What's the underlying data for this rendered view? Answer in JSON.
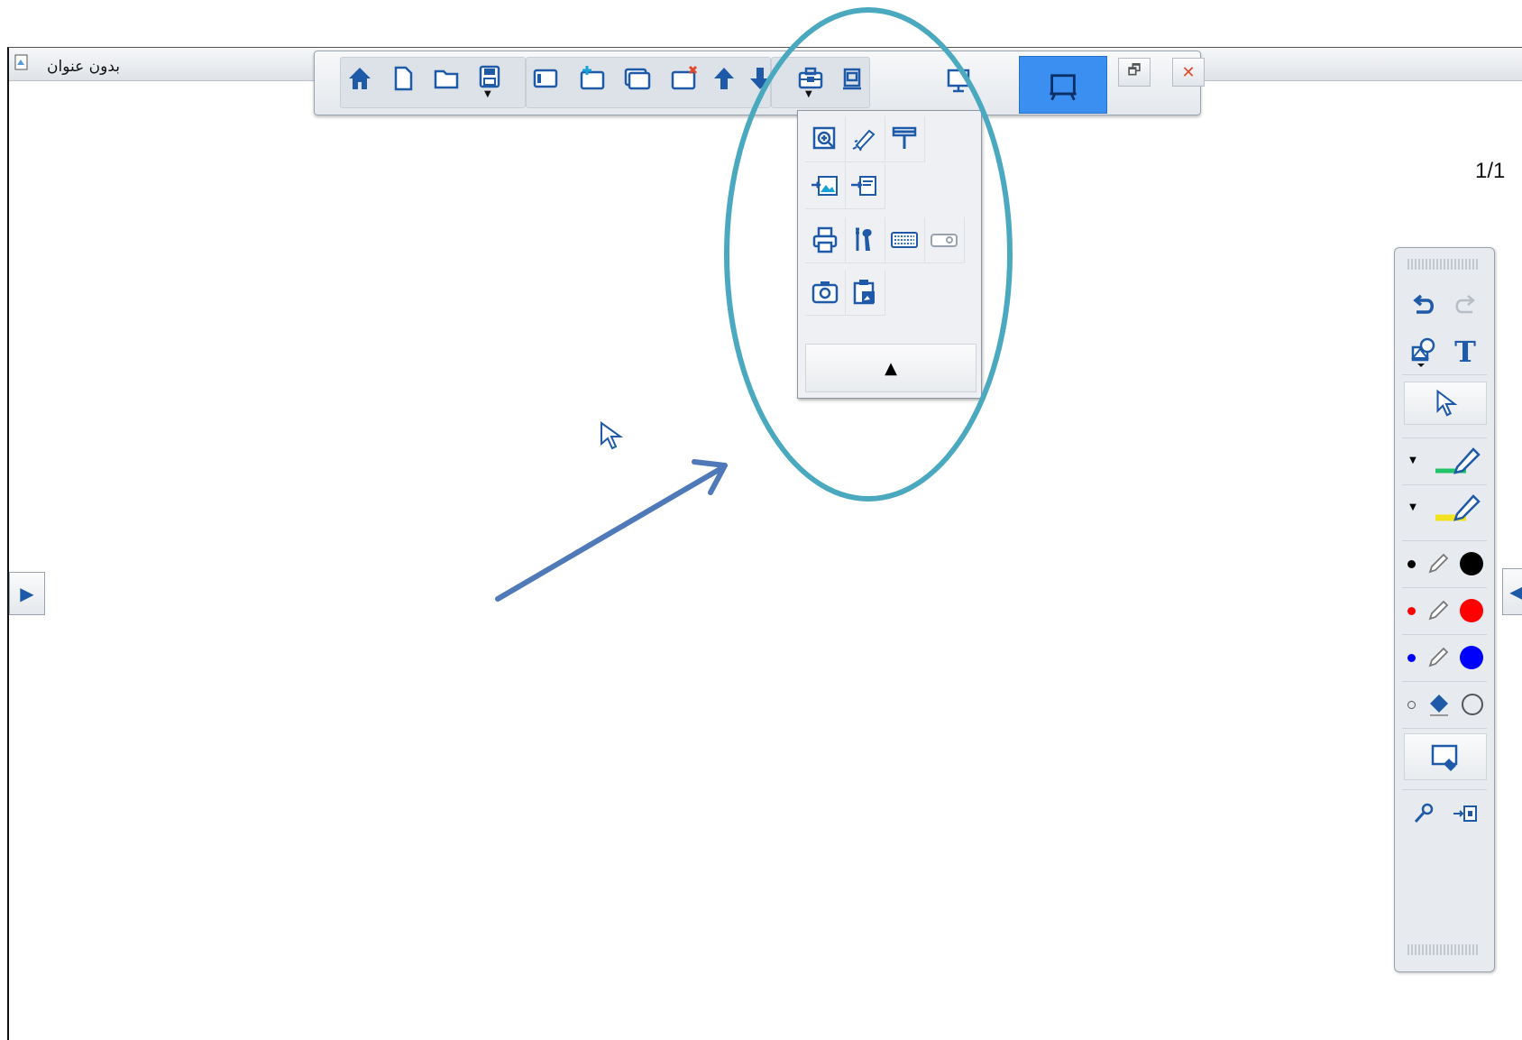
{
  "window": {
    "title": "بدون عنوان",
    "page_indicator": "1/1"
  },
  "toolbar": {
    "buttons": [
      "home-icon",
      "new-file-icon",
      "open-folder-icon",
      "save-icon",
      "page-view-icon",
      "add-page-icon",
      "duplicate-page-icon",
      "delete-page-icon",
      "page-up-icon",
      "page-down-icon",
      "toolbox-icon",
      "record-icon",
      "desktop-mode-icon",
      "whiteboard-mode-icon",
      "restore-window-icon",
      "close-window-icon"
    ],
    "restore_glyph": "🗗",
    "close_glyph": "✕"
  },
  "tools_menu": {
    "items": [
      "magnifier-icon",
      "spotlight-icon",
      "curtain-icon",
      "insert-image-icon",
      "insert-file-icon",
      "print-icon",
      "settings-icon",
      "keyboard-icon",
      "projector-icon",
      "camera-icon",
      "paste-icon"
    ],
    "collapse_glyph": "▲"
  },
  "side_toolbar": {
    "colors": {
      "black": "#000000",
      "red": "#ff0000",
      "blue": "#0000ff",
      "white": "#ffffff"
    },
    "highlighter_colors": [
      "#21c36a",
      "#f2e321"
    ],
    "dropdown_glyph": "▼",
    "text_tool_glyph": "T"
  },
  "nav": {
    "left_glyph": "▶",
    "right_glyph": "◀"
  },
  "annotation": {
    "accent": "#4aa9bf",
    "arrow_color": "#4f79b8"
  }
}
